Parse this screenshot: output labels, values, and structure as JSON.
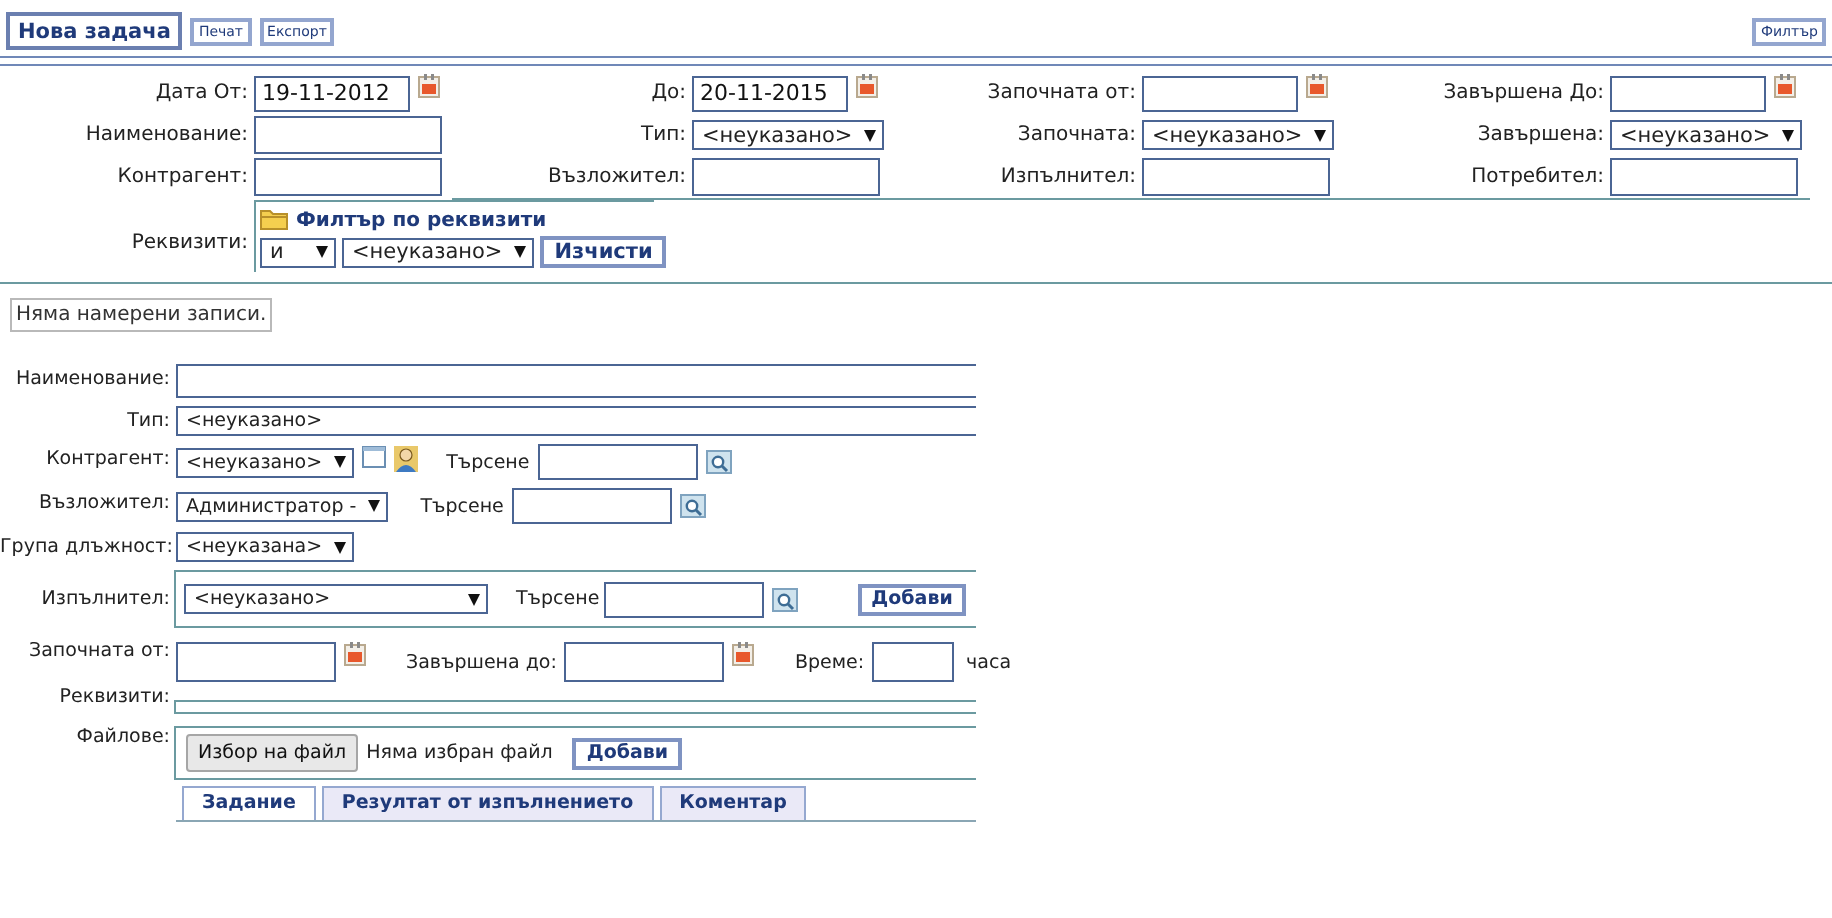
{
  "toolbar": {
    "buttons": [
      {
        "label": "Нова задача",
        "kind": "primary"
      },
      {
        "label": "Печат",
        "kind": "small"
      },
      {
        "label": "Експорт",
        "kind": "small"
      }
    ],
    "filter_button": "Филтър"
  },
  "filter": {
    "fields": [
      {
        "label": "Дата От:",
        "kind": "date",
        "value": "19-11-2012"
      },
      {
        "label": "До:",
        "kind": "date",
        "value": "20-11-2015"
      },
      {
        "label": "Започната от:",
        "kind": "date"
      },
      {
        "label": "Завършена До:",
        "kind": "date"
      },
      {
        "label": "Наименование:",
        "kind": "text"
      },
      {
        "label": "Тип:",
        "kind": "select",
        "value": "<неуказано>"
      },
      {
        "label": "Започната:",
        "kind": "select",
        "value": "<неуказано>"
      },
      {
        "label": "Завършена:",
        "kind": "select",
        "value": "<неуказано>"
      },
      {
        "label": "Контрагент:",
        "kind": "text"
      },
      {
        "label": "Възложител:",
        "kind": "text"
      },
      {
        "label": "Изпълнител:",
        "kind": "text"
      },
      {
        "label": "Потребител:",
        "kind": "text"
      }
    ],
    "requisites": {
      "label": "Реквизити:",
      "title": "Филтър по реквизити",
      "operator": "и",
      "property": "<неуказано>",
      "clear": "Изчисти"
    }
  },
  "message": "Няма намерени записи.",
  "task_form": {
    "rows": [
      {
        "kind": "text",
        "label": "Наименование:"
      },
      {
        "kind": "display",
        "label": "Тип:",
        "value": "<неуказано>"
      },
      {
        "kind": "contact_lookup",
        "label": "Контрагент:",
        "value": "<неуказано>",
        "search_label": "Търсене"
      },
      {
        "kind": "lookup",
        "label": "Възложител:",
        "value": "Администратор -",
        "search_label": "Търсене"
      },
      {
        "kind": "select",
        "label": "Група длъжност:",
        "value": "<неуказана>"
      },
      {
        "kind": "executor",
        "label": "Изпълнител:",
        "value": "<неуказано>",
        "search_label": "Търсене",
        "add": "Добави"
      },
      {
        "kind": "dates",
        "label": "Започната от:",
        "end_label": "Завършена до:",
        "time_label": "Време:",
        "unit": "часа"
      },
      {
        "kind": "empty_panel",
        "label": "Реквизити:"
      },
      {
        "kind": "files",
        "label": "Файлове:",
        "choose": "Избор на файл",
        "status": "Няма избран файл",
        "add": "Добави"
      }
    ],
    "tabs": [
      {
        "label": "Задание",
        "selected": true
      },
      {
        "label": "Резултат от изпълнението",
        "selected": false
      },
      {
        "label": "Коментар",
        "selected": false
      }
    ]
  }
}
